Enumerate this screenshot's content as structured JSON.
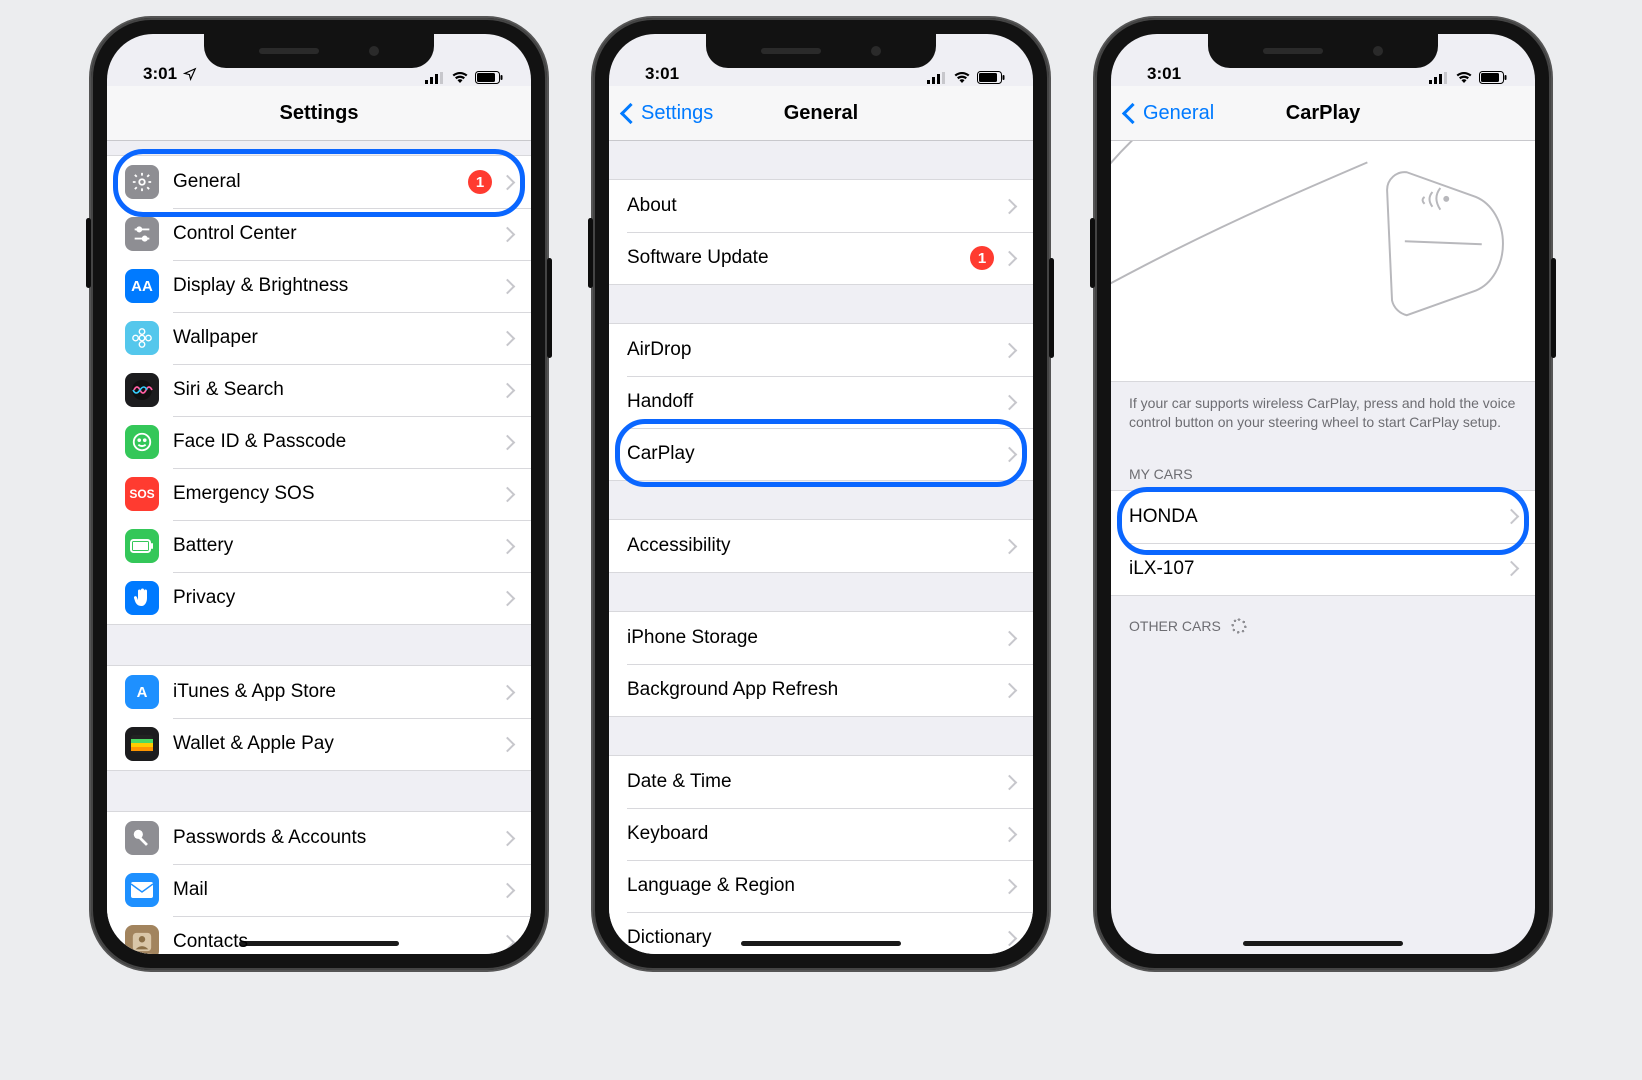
{
  "status": {
    "time": "3:01",
    "signal_bars": 4,
    "wifi": true,
    "battery_pct": 80
  },
  "phone1": {
    "title": "Settings",
    "group1": [
      {
        "key": "general",
        "label": "General",
        "icon": "gear",
        "color": "#8e8e93",
        "badge": "1",
        "highlight": true
      },
      {
        "key": "cc",
        "label": "Control Center",
        "icon": "sliders",
        "color": "#8e8e93"
      },
      {
        "key": "display",
        "label": "Display & Brightness",
        "icon": "AA",
        "color": "#007aff"
      },
      {
        "key": "wallpaper",
        "label": "Wallpaper",
        "icon": "flower",
        "color": "#54c7ec"
      },
      {
        "key": "siri",
        "label": "Siri & Search",
        "icon": "siri",
        "color": "#1c1c1e"
      },
      {
        "key": "faceid",
        "label": "Face ID & Passcode",
        "icon": "face",
        "color": "#34c759"
      },
      {
        "key": "sos",
        "label": "Emergency SOS",
        "icon": "SOS",
        "color": "#ff3b30"
      },
      {
        "key": "battery",
        "label": "Battery",
        "icon": "battery",
        "color": "#34c759"
      },
      {
        "key": "privacy",
        "label": "Privacy",
        "icon": "hand",
        "color": "#007aff"
      }
    ],
    "group2": [
      {
        "key": "itunes",
        "label": "iTunes & App Store",
        "icon": "A",
        "color": "#1e90ff"
      },
      {
        "key": "wallet",
        "label": "Wallet & Apple Pay",
        "icon": "wallet",
        "color": "#1c1c1e"
      }
    ],
    "group3": [
      {
        "key": "pw",
        "label": "Passwords & Accounts",
        "icon": "key",
        "color": "#8e8e93"
      },
      {
        "key": "mail",
        "label": "Mail",
        "icon": "mail",
        "color": "#1e90ff"
      },
      {
        "key": "contacts",
        "label": "Contacts",
        "icon": "contact",
        "color": "#a2845e"
      }
    ]
  },
  "phone2": {
    "back": "Settings",
    "title": "General",
    "group1": [
      {
        "key": "about",
        "label": "About"
      },
      {
        "key": "swu",
        "label": "Software Update",
        "badge": "1"
      }
    ],
    "group2": [
      {
        "key": "airdrop",
        "label": "AirDrop"
      },
      {
        "key": "handoff",
        "label": "Handoff"
      },
      {
        "key": "carplay",
        "label": "CarPlay",
        "highlight": true
      }
    ],
    "group3": [
      {
        "key": "acc",
        "label": "Accessibility"
      }
    ],
    "group4": [
      {
        "key": "storage",
        "label": "iPhone Storage"
      },
      {
        "key": "bgapp",
        "label": "Background App Refresh"
      }
    ],
    "group5": [
      {
        "key": "date",
        "label": "Date & Time"
      },
      {
        "key": "kbd",
        "label": "Keyboard"
      },
      {
        "key": "lang",
        "label": "Language & Region"
      },
      {
        "key": "dict",
        "label": "Dictionary"
      }
    ]
  },
  "phone3": {
    "back": "General",
    "title": "CarPlay",
    "note": "If your car supports wireless CarPlay, press and hold the voice control button on your steering wheel to start CarPlay setup.",
    "mycars_header": "MY CARS",
    "mycars": [
      {
        "key": "honda",
        "label": "HONDA",
        "highlight": true
      },
      {
        "key": "ilx",
        "label": "iLX-107"
      }
    ],
    "othercars_header": "OTHER CARS"
  }
}
